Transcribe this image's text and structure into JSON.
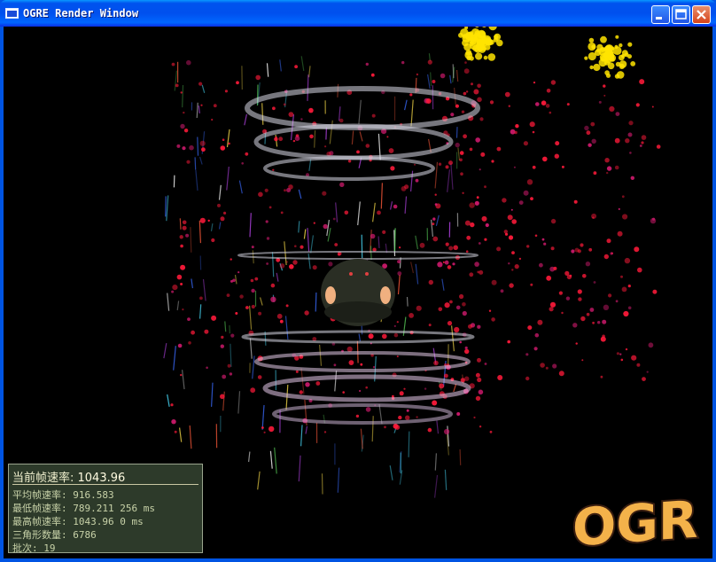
{
  "window": {
    "title": "OGRE Render Window",
    "title_icon": "window-icon",
    "controls": {
      "minimize": "minimize-icon",
      "maximize": "maximize-icon",
      "close": "close-icon"
    },
    "frame_color": "#0054e3"
  },
  "stats": {
    "current_fps_label": "当前帧速率: ",
    "current_fps_value": "1043.96",
    "rows": [
      {
        "label": "平均帧速率: ",
        "value": "916.583"
      },
      {
        "label": "最低帧速率: ",
        "value": "789.211 256 ms"
      },
      {
        "label": "最高帧速率: ",
        "value": "1043.96 0 ms"
      },
      {
        "label": "三角形数量: ",
        "value": "6786"
      },
      {
        "label": "批次: ",
        "value": "19"
      }
    ],
    "panel_color": "#3a4a36",
    "text_color": "#c8d2a8"
  },
  "logo": {
    "text": "OGRE",
    "fill": "#f4b24a",
    "outline": "#3a1e10"
  },
  "scene": {
    "background": "#000000",
    "particle_colors": [
      "#ff1a3a",
      "#d21a6e",
      "#ffe400",
      "#cfd6e6"
    ]
  }
}
